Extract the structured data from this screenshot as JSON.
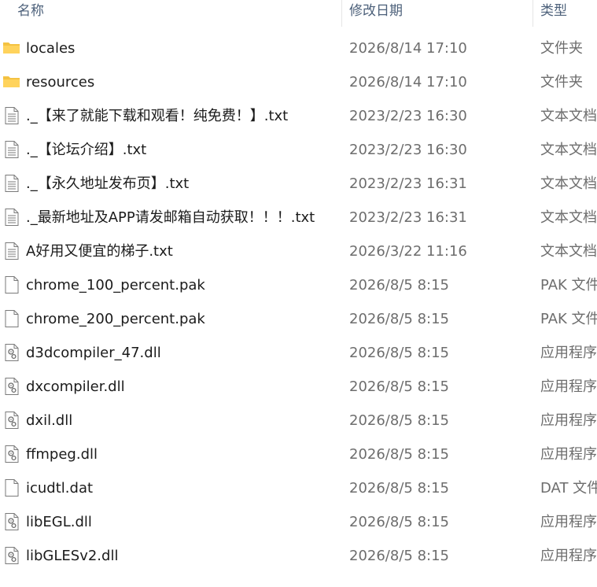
{
  "header": {
    "name_label": "名称",
    "date_label": "修改日期",
    "type_label": "类型"
  },
  "colors": {
    "folder": "#f4c242",
    "header_text": "#4c607a",
    "meta_text": "#6d6d6d"
  },
  "files": [
    {
      "name": "locales",
      "date": "2026/8/14 17:10",
      "type": "文件夹",
      "icon": "folder-icon"
    },
    {
      "name": "resources",
      "date": "2026/8/14 17:10",
      "type": "文件夹",
      "icon": "folder-icon"
    },
    {
      "name": "._【来了就能下载和观看！纯免费！】.txt",
      "date": "2023/2/23 16:30",
      "type": "文本文档",
      "icon": "text-file-icon"
    },
    {
      "name": "._【论坛介绍】.txt",
      "date": "2023/2/23 16:30",
      "type": "文本文档",
      "icon": "text-file-icon"
    },
    {
      "name": "._【永久地址发布页】.txt",
      "date": "2023/2/23 16:31",
      "type": "文本文档",
      "icon": "text-file-icon"
    },
    {
      "name": "._最新地址及APP请发邮箱自动获取！！！.txt",
      "date": "2023/2/23 16:31",
      "type": "文本文档",
      "icon": "text-file-icon"
    },
    {
      "name": "A好用又便宜的梯子.txt",
      "date": "2026/3/22 11:16",
      "type": "文本文档",
      "icon": "text-file-icon"
    },
    {
      "name": "chrome_100_percent.pak",
      "date": "2026/8/5 8:15",
      "type": "PAK 文件",
      "icon": "blank-file-icon"
    },
    {
      "name": "chrome_200_percent.pak",
      "date": "2026/8/5 8:15",
      "type": "PAK 文件",
      "icon": "blank-file-icon"
    },
    {
      "name": "d3dcompiler_47.dll",
      "date": "2026/8/5 8:15",
      "type": "应用程序扩展",
      "icon": "dll-file-icon"
    },
    {
      "name": "dxcompiler.dll",
      "date": "2026/8/5 8:15",
      "type": "应用程序扩展",
      "icon": "dll-file-icon"
    },
    {
      "name": "dxil.dll",
      "date": "2026/8/5 8:15",
      "type": "应用程序扩展",
      "icon": "dll-file-icon"
    },
    {
      "name": "ffmpeg.dll",
      "date": "2026/8/5 8:15",
      "type": "应用程序扩展",
      "icon": "dll-file-icon"
    },
    {
      "name": "icudtl.dat",
      "date": "2026/8/5 8:15",
      "type": "DAT 文件",
      "icon": "blank-file-icon"
    },
    {
      "name": "libEGL.dll",
      "date": "2026/8/5 8:15",
      "type": "应用程序扩展",
      "icon": "dll-file-icon"
    },
    {
      "name": "libGLESv2.dll",
      "date": "2026/8/5 8:15",
      "type": "应用程序扩展",
      "icon": "dll-file-icon"
    }
  ]
}
